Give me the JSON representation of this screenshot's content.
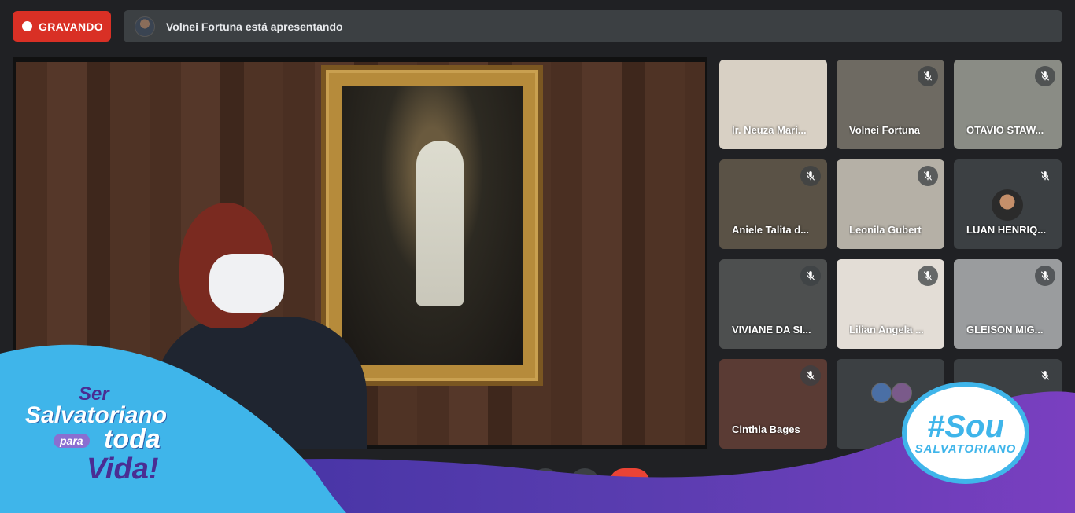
{
  "recording": {
    "label": "GRAVANDO"
  },
  "presenting": {
    "text": "Volnei Fortuna está apresentando"
  },
  "participants": [
    {
      "name": "Ir. Neuza Mari...",
      "muted": false,
      "bg": "#d8d0c4"
    },
    {
      "name": "Volnei Fortuna",
      "muted": true,
      "bg": "#6e6a62"
    },
    {
      "name": "OTAVIO STAW...",
      "muted": true,
      "bg": "#8a8c85"
    },
    {
      "name": "Aniele Talita d...",
      "muted": true,
      "bg": "#5a5246"
    },
    {
      "name": "Leonila Gubert",
      "muted": true,
      "bg": "#b5b0a6"
    },
    {
      "name": "LUAN HENRIQ...",
      "muted": true,
      "bg": "#3c4043"
    },
    {
      "name": "VIVIANE DA SI...",
      "muted": true,
      "bg": "#4d4f4f"
    },
    {
      "name": "Lilian Angela ...",
      "muted": true,
      "bg": "#e3ddd6"
    },
    {
      "name": "GLEISON MIG...",
      "muted": true,
      "bg": "#9a9c9e"
    },
    {
      "name": "Cinthia Bages",
      "muted": true,
      "bg": "#5a3b34"
    },
    {
      "name": "",
      "muted": false,
      "bg": "#3c4043"
    },
    {
      "name": "",
      "muted": true,
      "bg": "#3c4043"
    }
  ],
  "branding": {
    "left": {
      "line1": "Ser",
      "line2": "Salvatoriano",
      "line3": "para",
      "line4": "toda",
      "line5": "Vida!"
    },
    "right": {
      "hashtag": "#Sou",
      "word": "SALVATORIANO"
    }
  },
  "colors": {
    "record": "#d93025",
    "wave_blue": "#3fb5ea",
    "wave_purple": "#5a3db0"
  }
}
